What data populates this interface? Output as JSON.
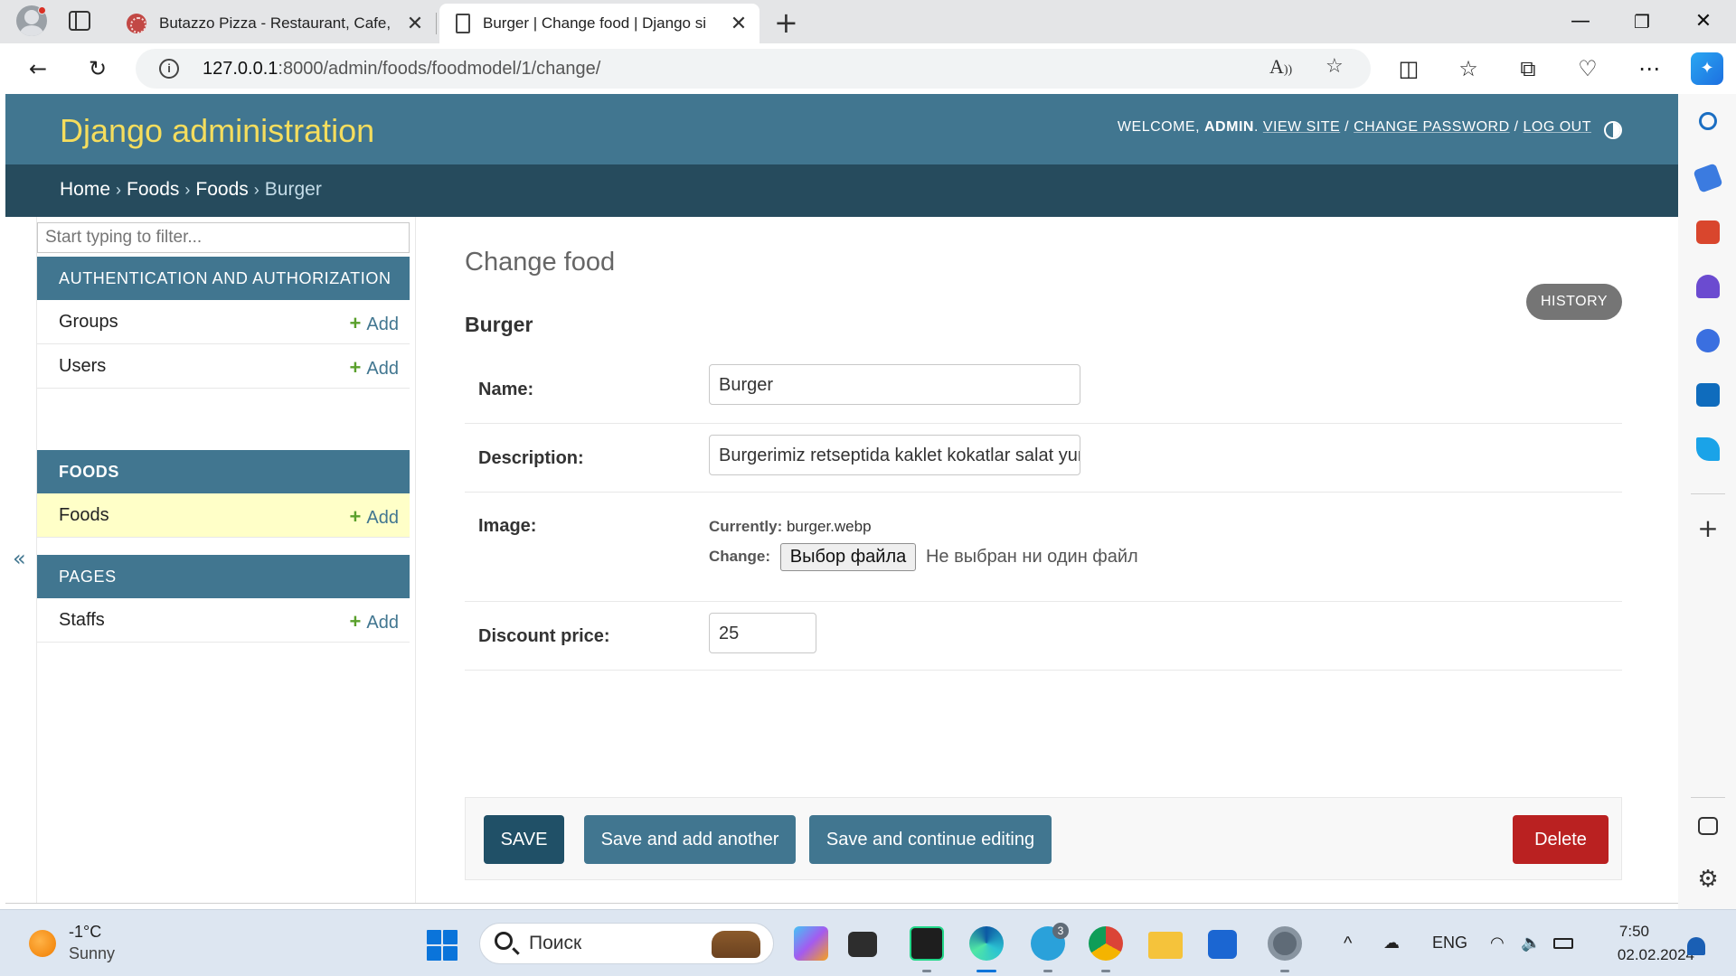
{
  "browser": {
    "tabs": [
      {
        "title": "Butazzo Pizza - Restaurant, Cafe,",
        "active": false
      },
      {
        "title": "Burger | Change food | Django si",
        "active": true
      }
    ],
    "url_host": "127.0.0.1",
    "url_path": ":8000/admin/foods/foodmodel/1/change/"
  },
  "admin": {
    "site_title": "Django administration",
    "welcome": "WELCOME,",
    "username": "ADMIN",
    "view_site": "VIEW SITE",
    "change_password": "CHANGE PASSWORD",
    "log_out": "LOG OUT",
    "breadcrumbs": [
      "Home",
      "Foods",
      "Foods",
      "Burger"
    ],
    "nav_toggle": "«",
    "filter_placeholder": "Start typing to filter...",
    "modules": [
      {
        "name": "AUTHENTICATION AND AUTHORIZATION",
        "models": [
          {
            "name": "Groups",
            "add": "Add"
          },
          {
            "name": "Users",
            "add": "Add"
          }
        ]
      },
      {
        "name": "FOODS",
        "models": [
          {
            "name": "Foods",
            "add": "Add",
            "current": true
          }
        ]
      },
      {
        "name": "PAGES",
        "models": [
          {
            "name": "Staffs",
            "add": "Add"
          }
        ]
      }
    ],
    "page_title": "Change food",
    "history": "HISTORY",
    "object_title": "Burger",
    "fields": {
      "name_label": "Name:",
      "name_value": "Burger",
      "description_label": "Description:",
      "description_value": "Burgerimiz retseptida kaklet kokatlar salat yur",
      "image_label": "Image:",
      "currently_label": "Currently:",
      "currently_value": "burger.webp",
      "change_label": "Change:",
      "file_button": "Выбор файла",
      "file_none": "Не выбран ни один файл",
      "discount_label": "Discount price:",
      "discount_value": "25"
    },
    "buttons": {
      "save": "SAVE",
      "save_add": "Save and add another",
      "save_continue": "Save and continue editing",
      "delete": "Delete"
    }
  },
  "taskbar": {
    "temperature": "-1°C",
    "weather": "Sunny",
    "search_placeholder": "Поиск",
    "telegram_badge": "3",
    "language": "ENG",
    "time": "7:50",
    "date": "02.02.2024"
  },
  "colors": {
    "header": "#417690",
    "breadcrumbs": "#264b5d",
    "brand_text": "#f5dd5d",
    "save": "#205067",
    "delete": "#ba2121",
    "current_row": "#ffffc8"
  }
}
